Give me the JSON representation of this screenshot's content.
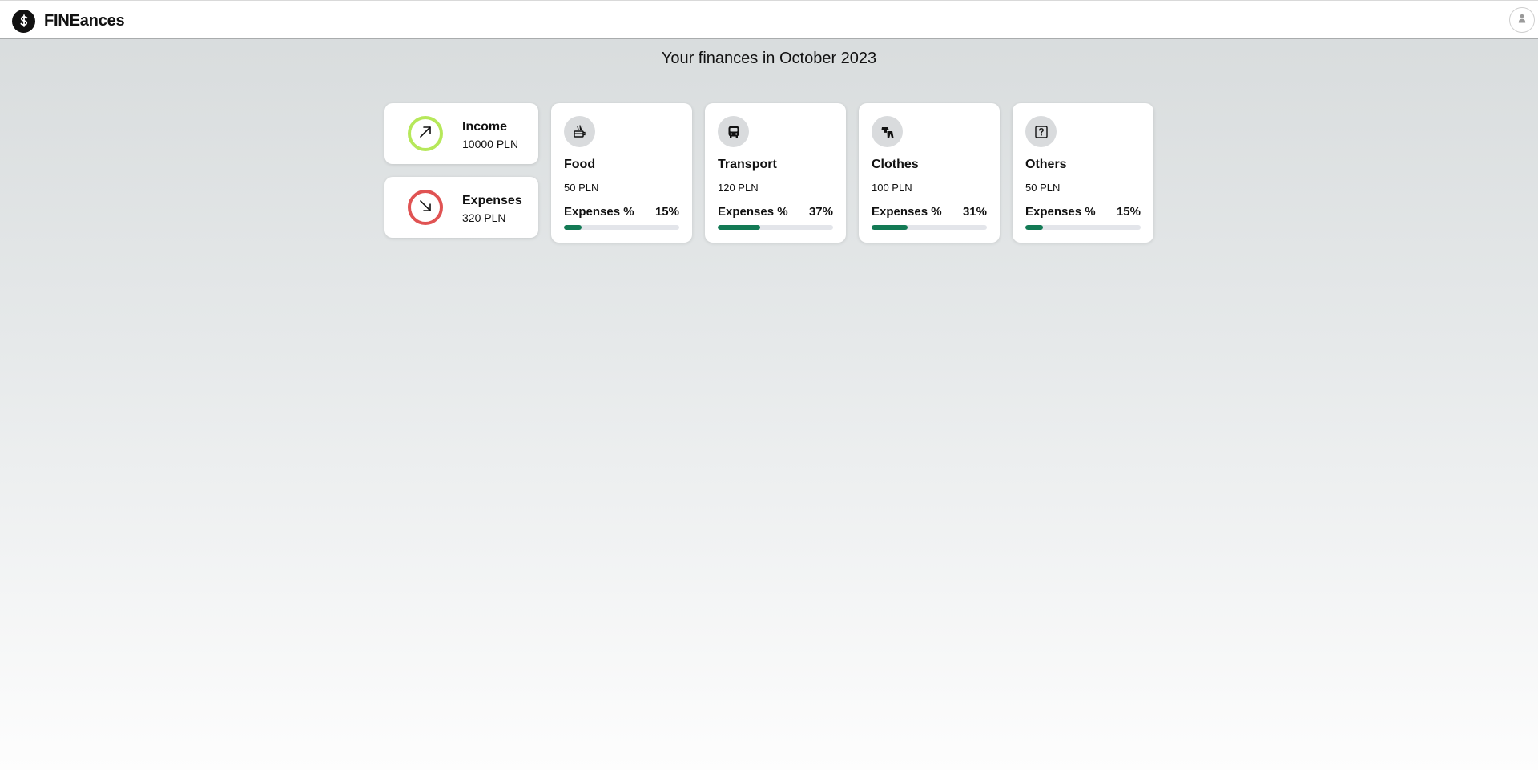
{
  "header": {
    "brand": "FINEances",
    "brand_icon": "dollar-icon",
    "user_icon": "user-icon"
  },
  "main": {
    "title": "Your finances in October 2023",
    "summary": [
      {
        "label": "Income",
        "amount": "10000 PLN",
        "icon": "arrow-up-right-icon",
        "color": "#b6e85a"
      },
      {
        "label": "Expenses",
        "amount": "320 PLN",
        "icon": "arrow-down-right-icon",
        "color": "#e05353"
      }
    ],
    "categories": [
      {
        "name": "Food",
        "amount": "50 PLN",
        "expenses_label": "Expenses %",
        "expenses_value": "15%",
        "percent": 15,
        "icon": "food-icon"
      },
      {
        "name": "Transport",
        "amount": "120 PLN",
        "expenses_label": "Expenses %",
        "expenses_value": "37%",
        "percent": 37,
        "icon": "bus-icon"
      },
      {
        "name": "Clothes",
        "amount": "100 PLN",
        "expenses_label": "Expenses %",
        "expenses_value": "31%",
        "percent": 31,
        "icon": "clothes-icon"
      },
      {
        "name": "Others",
        "amount": "50 PLN",
        "expenses_label": "Expenses %",
        "expenses_value": "15%",
        "percent": 15,
        "icon": "question-icon"
      }
    ],
    "bar_color": "#137a55"
  }
}
